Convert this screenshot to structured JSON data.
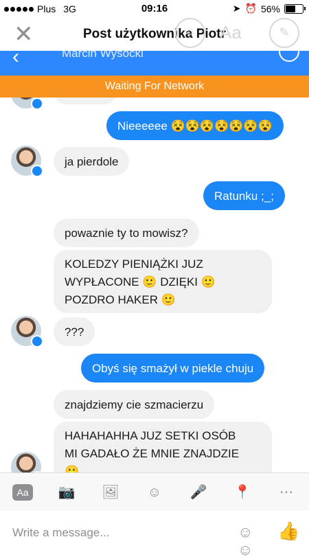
{
  "status_bar": {
    "carrier": "Plus",
    "network": "3G",
    "time": "09:16",
    "battery": "56%"
  },
  "post_header": {
    "title": "Post użytkownika Piotr",
    "close_icon": "close-icon",
    "aa_label": "Aa"
  },
  "chat_header": {
    "name": "Marcin Wysocki"
  },
  "network_banner": "Waiting For Network",
  "messages": [
    {
      "text": "Nieeeeee 😵😵😵😵😵😵😵"
    },
    {
      "text": "ja pierdole"
    },
    {
      "text": "Ratunku ;_;"
    },
    {
      "text": "powaznie ty to mowisz?"
    },
    {
      "line1": "KOLEDZY PIENIĄŻKI JUZ",
      "line2": "WYPŁACONE 🙂 DZIĘKI 🙂",
      "line3": "POZDRO HAKER 🙂"
    },
    {
      "text": "???"
    },
    {
      "text": "Obyś się smażył w piekle chuju"
    },
    {
      "text": "znajdziemy cie szmacierzu"
    },
    {
      "line1": "HAHAHAHHA JUZ SETKI OSÓB",
      "line2": "MI GADAŁO ŻE MNIE ZNAJDZIE",
      "line3": "🙂"
    }
  ],
  "composer": {
    "placeholder": "Write a message..."
  }
}
